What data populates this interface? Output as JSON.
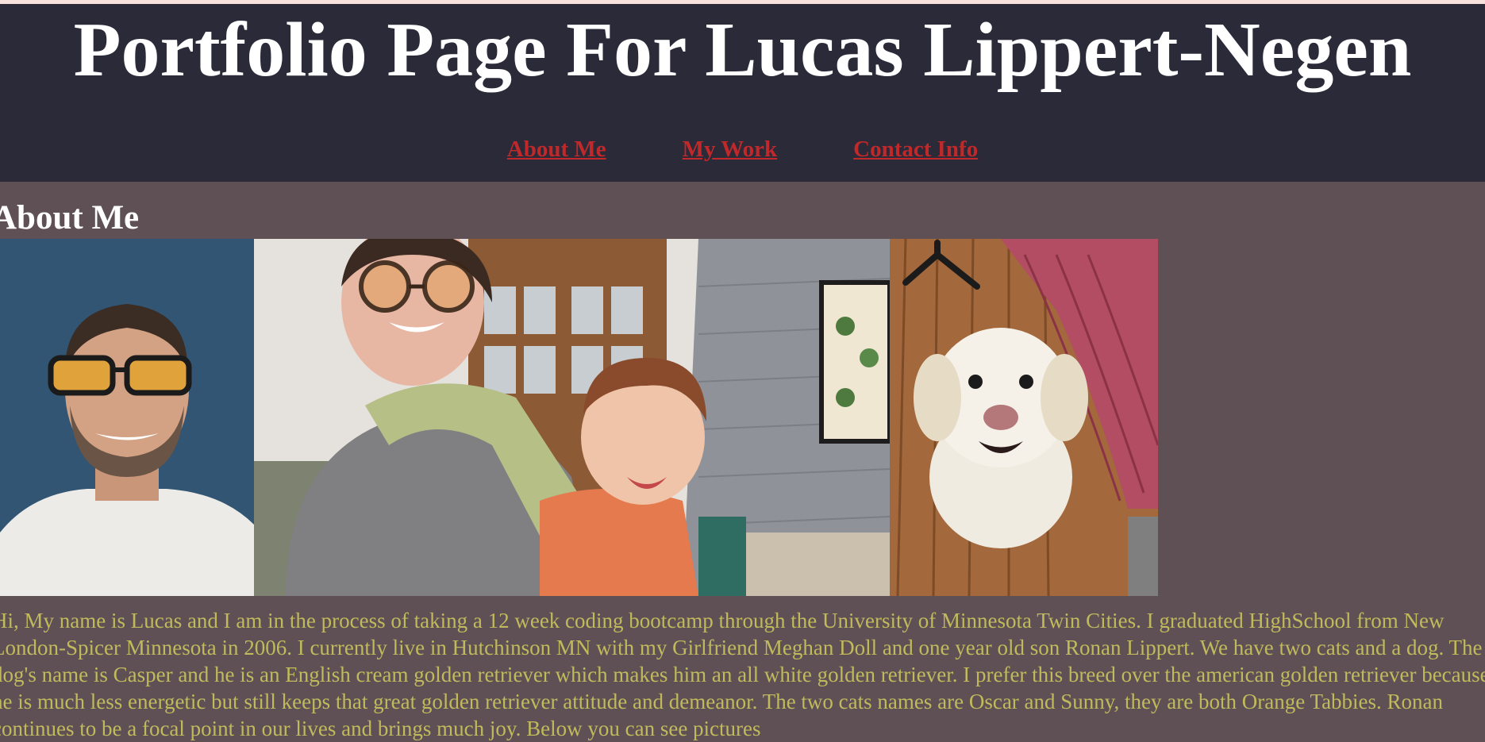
{
  "header": {
    "title": "Portfolio Page For Lucas Lippert-Negen",
    "nav": [
      {
        "label": "About Me"
      },
      {
        "label": "My Work"
      },
      {
        "label": "Contact Info"
      }
    ]
  },
  "about": {
    "heading": "About Me",
    "photos": [
      {
        "subject": "portrait-of-lucas"
      },
      {
        "subject": "meghan-and-ronan"
      },
      {
        "subject": "casper-the-dog"
      }
    ],
    "bio": "Hi, My name is Lucas and I am in the process of taking a 12 week coding bootcamp through the University of Minnesota Twin Cities. I graduated HighSchool from New London-Spicer Minnesota in 2006. I currently live in Hutchinson MN with my Girlfriend Meghan Doll and one year old son Ronan Lippert. We have two cats and a dog. The dog's name is Casper and he is an English cream golden retriever which makes him an all white golden retriever. I prefer this breed over the american golden retriever because he is much less energetic but still keeps that great golden retriever attitude and demeanor. The two cats names are Oscar and Sunny, they are both Orange Tabbies. Ronan continues to be a focal point in our lives and brings much joy. Below you can see pictures"
  },
  "colors": {
    "page_background": "#5e5055",
    "header_background": "#2a2a38",
    "nav_link": "#c0282a",
    "bio_text": "#c1ba5c",
    "title_text": "#ffffff"
  }
}
